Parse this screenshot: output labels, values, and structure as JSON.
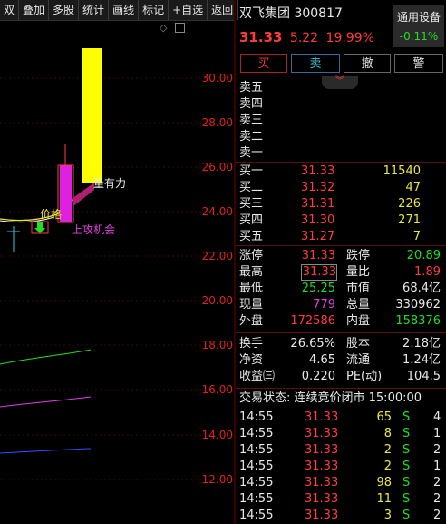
{
  "toolbar": {
    "items": [
      "双",
      "叠加",
      "多股",
      "统计",
      "画线",
      "标记",
      "+自选",
      "返回"
    ]
  },
  "chart": {
    "y_labels": [
      "30.00",
      "28.00",
      "26.00",
      "24.00",
      "22.00",
      "20.00",
      "18.00",
      "16.00",
      "14.00",
      "12.00"
    ],
    "annotations": {
      "strong": "量有力",
      "price": "价格",
      "attack": "上攻机会"
    },
    "colors": {
      "up_candle": "#e020e0",
      "volume_bar": "#ffff00",
      "ma_green": "#22dd22",
      "ma_pink": "#e040e0",
      "ma_blue": "#3050ff"
    }
  },
  "header": {
    "stock_name": "双飞集团",
    "code": "300817",
    "price": "31.33",
    "change": "5.22",
    "change_pct": "19.99%",
    "setting_label": "通用设备",
    "setting_pct": "-0.11%"
  },
  "trade_buttons": [
    "买",
    "卖",
    "撤",
    "警"
  ],
  "sells": [
    {
      "label": "卖五",
      "price": "",
      "vol": ""
    },
    {
      "label": "卖四",
      "price": "",
      "vol": ""
    },
    {
      "label": "卖三",
      "price": "",
      "vol": ""
    },
    {
      "label": "卖二",
      "price": "",
      "vol": ""
    },
    {
      "label": "卖一",
      "price": "",
      "vol": ""
    }
  ],
  "buys": [
    {
      "label": "买一",
      "price": "31.33",
      "vol": "11540"
    },
    {
      "label": "买二",
      "price": "31.32",
      "vol": "47"
    },
    {
      "label": "买三",
      "price": "31.31",
      "vol": "226"
    },
    {
      "label": "买四",
      "price": "31.30",
      "vol": "271"
    },
    {
      "label": "买五",
      "price": "31.27",
      "vol": "7"
    }
  ],
  "stats": [
    {
      "l1": "涨停",
      "v1": "31.33",
      "c1": "red",
      "l2": "跌停",
      "v2": "20.89",
      "c2": "green"
    },
    {
      "l1": "最高",
      "v1": "31.33",
      "c1": "red",
      "l2": "量比",
      "v2": "1.89",
      "c2": "red"
    },
    {
      "l1": "最低",
      "v1": "25.25",
      "c1": "green",
      "l2": "市值",
      "v2": "68.4亿",
      "c2": "white"
    },
    {
      "l1": "现量",
      "v1": "779",
      "c1": "magenta",
      "l2": "总量",
      "v2": "330962",
      "c2": "white"
    },
    {
      "l1": "外盘",
      "v1": "172586",
      "c1": "red",
      "l2": "内盘",
      "v2": "158376",
      "c2": "green"
    }
  ],
  "stats2": [
    {
      "l1": "换手",
      "v1": "26.65%",
      "l2": "股本",
      "v2": "2.18亿"
    },
    {
      "l1": "净资",
      "v1": "4.65",
      "l2": "流通",
      "v2": "1.24亿"
    },
    {
      "l1": "收益㈢",
      "v1": "0.220",
      "l2": "PE(动)",
      "v2": "104.5"
    }
  ],
  "trade_status": "交易状态: 连续竞价闭市 15:00:00",
  "ticks": [
    {
      "time": "14:55",
      "price": "31.33",
      "vol": "65",
      "side": "S",
      "n": "4"
    },
    {
      "time": "14:55",
      "price": "31.33",
      "vol": "8",
      "side": "S",
      "n": "1"
    },
    {
      "time": "14:55",
      "price": "31.33",
      "vol": "2",
      "side": "S",
      "n": "2"
    },
    {
      "time": "14:55",
      "price": "31.33",
      "vol": "2",
      "side": "S",
      "n": "1"
    },
    {
      "time": "14:55",
      "price": "31.33",
      "vol": "98",
      "side": "S",
      "n": "2"
    },
    {
      "time": "14:55",
      "price": "31.33",
      "vol": "11",
      "side": "S",
      "n": "2"
    },
    {
      "time": "14:55",
      "price": "31.33",
      "vol": "3",
      "side": "S",
      "n": "2"
    }
  ]
}
